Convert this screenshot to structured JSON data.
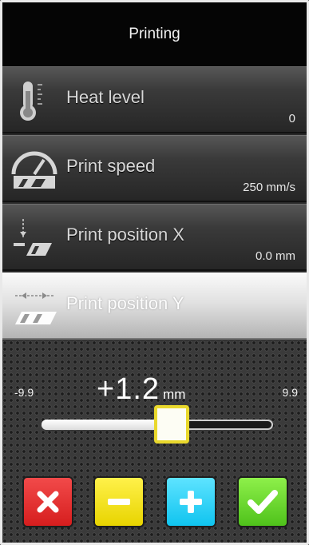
{
  "header": {
    "title": "Printing"
  },
  "menu": [
    {
      "label": "Heat level",
      "value": "0",
      "icon": "thermometer-icon"
    },
    {
      "label": "Print speed",
      "value": "250 mm/s",
      "icon": "speedometer-icon"
    },
    {
      "label": "Print position X",
      "value": "0.0 mm",
      "icon": "position-x-icon"
    },
    {
      "label": "Print position Y",
      "value": "",
      "icon": "position-y-icon",
      "selected": true
    }
  ],
  "adjust": {
    "min_label": "-9.9",
    "max_label": "9.9",
    "value": "+1.2",
    "unit": "mm",
    "level": 1.2,
    "min": -9.9,
    "max": 9.9
  },
  "buttons": {
    "cancel_icon": "close-icon",
    "minus_icon": "minus-icon",
    "plus_icon": "plus-icon",
    "confirm_icon": "check-icon"
  },
  "colors": {
    "cancel": "#e53232",
    "minus": "#f2e000",
    "plus": "#2ad0f6",
    "confirm": "#6cd92e",
    "thumb_border": "#e9d82c"
  }
}
